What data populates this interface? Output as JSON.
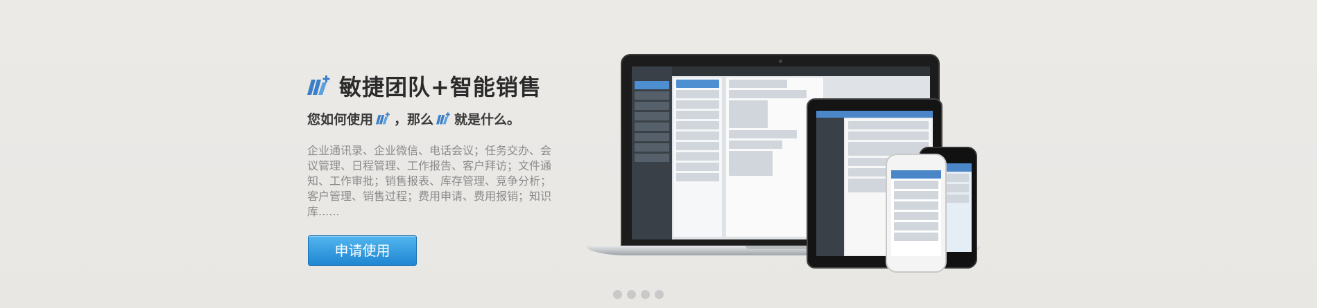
{
  "hero": {
    "headline": "敏捷团队+智能销售",
    "subline_prefix": "您如何使用",
    "subline_middle": "，那么",
    "subline_suffix": "就是什么。",
    "description": "企业通讯录、企业微信、电话会议；任务交办、会议管理、日程管理、工作报告、客户拜访；文件通知、工作审批；销售报表、库存管理、竞争分析；客户管理、销售过程；费用申请、费用报销；知识库......",
    "cta_label": "申请使用"
  },
  "carousel": {
    "dots": 4,
    "active_index": 0
  },
  "colors": {
    "background": "#ebeae8",
    "accent": "#1f86d2",
    "logo": "#3a7fc7"
  },
  "icons": {
    "brand_logo": "logo-icon",
    "carousel_dot": "dot-icon"
  }
}
